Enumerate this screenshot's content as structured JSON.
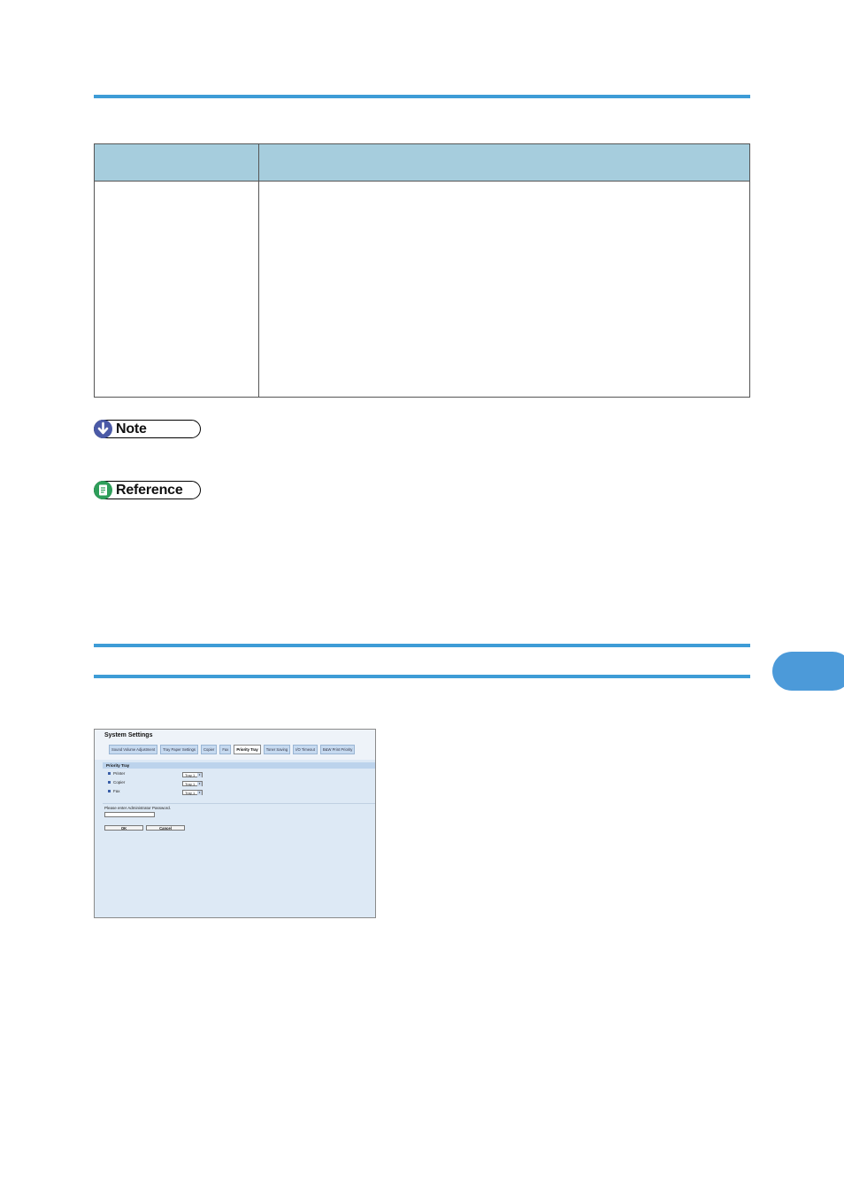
{
  "table": {
    "header_left": "",
    "header_right": ""
  },
  "note": {
    "label": "Note"
  },
  "reference": {
    "label": "Reference"
  },
  "screenshot": {
    "title": "System Settings",
    "tabs": [
      {
        "label": "Sound Volume Adjustment",
        "active": false
      },
      {
        "label": "Tray Paper Settings",
        "active": false
      },
      {
        "label": "Copier",
        "active": false
      },
      {
        "label": "Fax",
        "active": false
      },
      {
        "label": "Priority Tray",
        "active": true
      },
      {
        "label": "Toner Saving",
        "active": false
      },
      {
        "label": "I/O Timeout",
        "active": false
      },
      {
        "label": "B&W Print Priority",
        "active": false
      }
    ],
    "section_title": "Priority Tray",
    "rows": [
      {
        "label": "Printer",
        "value": "Tray 1"
      },
      {
        "label": "Copier",
        "value": "Tray 1"
      },
      {
        "label": "Fax",
        "value": "Tray 1"
      }
    ],
    "password_label": "Please enter Administrator Password.",
    "ok_label": "OK",
    "cancel_label": "Cancel"
  },
  "colors": {
    "rule": "#3e9cd6",
    "table_header": "#a6cddd",
    "note_icon": "#4b5aa7",
    "reference_icon": "#2e9e5a",
    "chapter_tab": "#4c9ad9"
  }
}
